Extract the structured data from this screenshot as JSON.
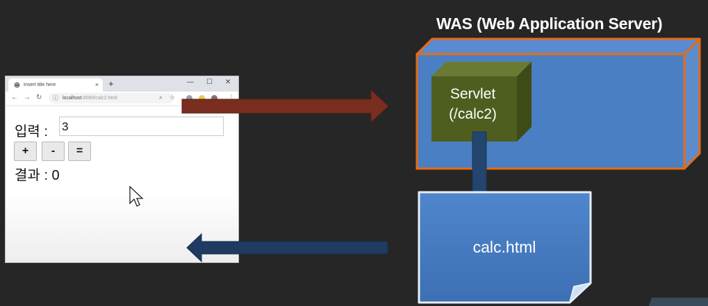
{
  "browser": {
    "tab_title": "Insert title here",
    "tab_close": "×",
    "new_tab": "+",
    "url_host": "localhost",
    "url_path": ":8080/calc2.html",
    "page": {
      "input_label": "입력 :",
      "input_value": "3",
      "buttons": [
        "+",
        "-",
        "="
      ],
      "result_label": "결과 : 0"
    }
  },
  "was": {
    "title": "WAS (Web Application Server)",
    "servlet_line1": "Servlet",
    "servlet_line2": "(/calc2)"
  },
  "output_file": {
    "label": "calc.html"
  },
  "colors": {
    "background": "#262626",
    "request_arrow": "#7a2e20",
    "response_arrow": "#1f3b63",
    "server_box": "#4a7fc4",
    "server_border": "#e86b12",
    "servlet_box": "#4e5e1f",
    "document": "#4a7fc4"
  }
}
